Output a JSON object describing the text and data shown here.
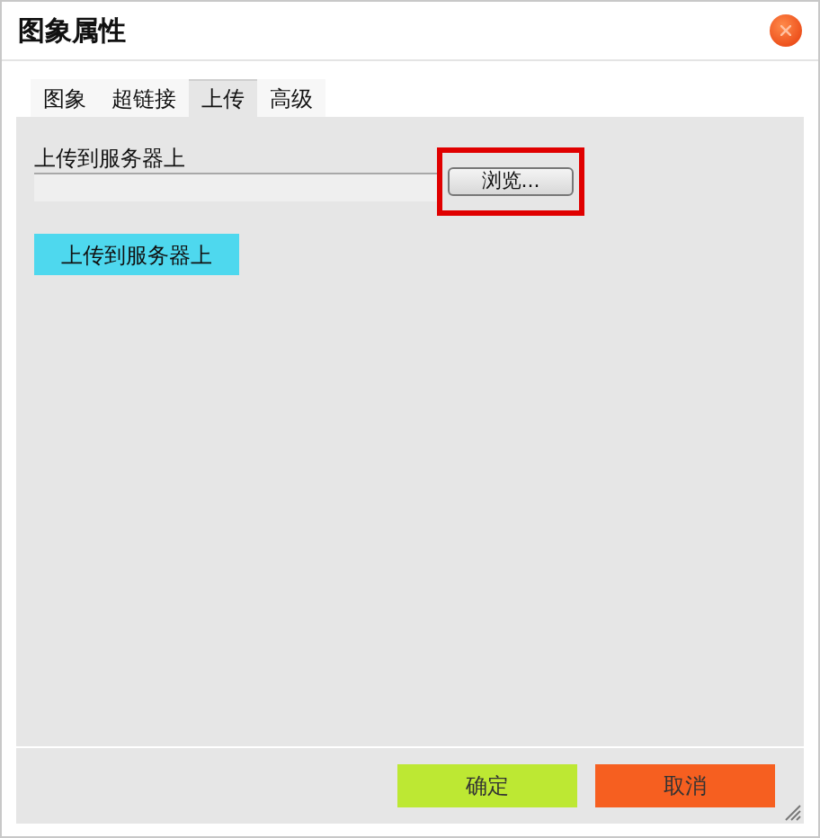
{
  "window": {
    "title": "图象属性"
  },
  "tabs": [
    {
      "label": "图象",
      "selected": false
    },
    {
      "label": "超链接",
      "selected": false
    },
    {
      "label": "上传",
      "selected": true
    },
    {
      "label": "高级",
      "selected": false
    }
  ],
  "upload": {
    "label": "上传到服务器上",
    "browse_button": "浏览...",
    "browse_highlighted": true,
    "submit_button": "上传到服务器上"
  },
  "buttons": [
    {
      "label": "确定",
      "kind": "ok"
    },
    {
      "label": "取消",
      "kind": "cancel"
    }
  ]
}
